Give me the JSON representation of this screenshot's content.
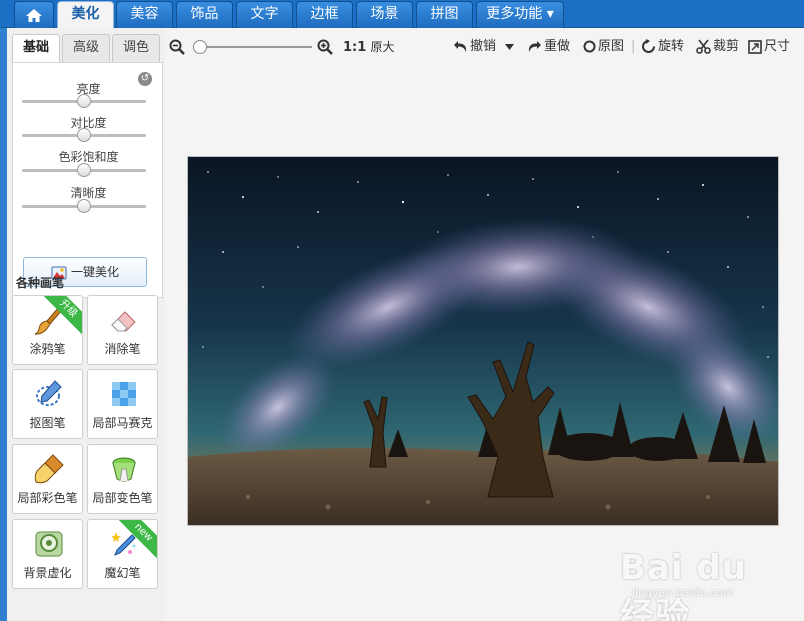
{
  "top_nav": {
    "home_icon": "home-icon",
    "tabs": [
      {
        "label": "美化",
        "active": true
      },
      {
        "label": "美容"
      },
      {
        "label": "饰品"
      },
      {
        "label": "文字"
      },
      {
        "label": "边框"
      },
      {
        "label": "场景"
      },
      {
        "label": "拼图"
      },
      {
        "label": "更多功能 ▾"
      }
    ]
  },
  "left_panel": {
    "tabs": [
      {
        "label": "基础",
        "active": true
      },
      {
        "label": "高级"
      },
      {
        "label": "调色"
      }
    ],
    "adjustments": [
      {
        "label": "亮度",
        "value": 0.5
      },
      {
        "label": "对比度",
        "value": 0.5
      },
      {
        "label": "色彩饱和度",
        "value": 0.5
      },
      {
        "label": "清晰度",
        "value": 0.5
      }
    ],
    "auto_beautify_label": "一键美化",
    "brushes_title": "各种画笔",
    "brushes": [
      {
        "label": "涂鸦笔",
        "badge": "升级",
        "icon": "brush-icon"
      },
      {
        "label": "消除笔",
        "icon": "eraser-icon"
      },
      {
        "label": "抠图笔",
        "icon": "cutout-pen-icon"
      },
      {
        "label": "局部马赛克",
        "icon": "mosaic-icon"
      },
      {
        "label": "局部彩色笔",
        "icon": "color-brush-icon"
      },
      {
        "label": "局部变色笔",
        "icon": "color-change-icon"
      },
      {
        "label": "背景虚化",
        "icon": "blur-background-icon"
      },
      {
        "label": "魔幻笔",
        "badge": "new",
        "icon": "magic-pen-icon"
      }
    ]
  },
  "toolbar": {
    "zoom_value": 0.05,
    "ratio_label": "1:1",
    "original_size_label": "原大",
    "undo_label": "撤销",
    "redo_label": "重做",
    "original_label": "原图",
    "rotate_label": "旋转",
    "crop_label": "裁剪",
    "size_label": "尺寸"
  },
  "watermark": {
    "brand": "Bai  du 经验",
    "url": "jingyan.baidu.com"
  },
  "colors": {
    "nav_blue": "#1b6fc4",
    "badge_green": "#3db847"
  }
}
